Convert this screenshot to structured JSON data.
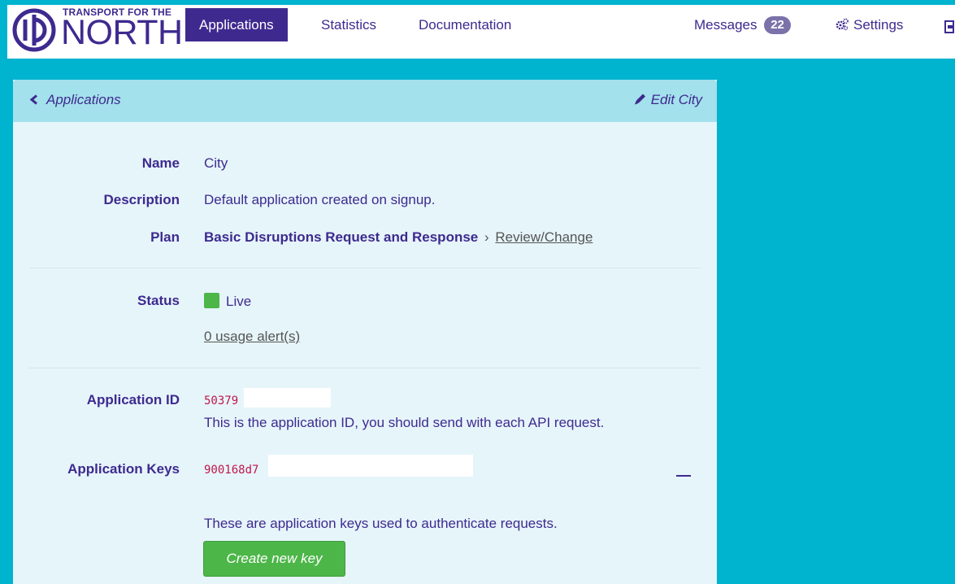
{
  "brand": {
    "small": "TRANSPORT FOR THE",
    "big": "NORTH"
  },
  "nav": {
    "applications": "Applications",
    "statistics": "Statistics",
    "documentation": "Documentation",
    "messages": "Messages",
    "messages_count": "22",
    "settings": "Settings"
  },
  "panel": {
    "back": "Applications",
    "edit": "Edit City"
  },
  "details": {
    "name_label": "Name",
    "name_value": "City",
    "description_label": "Description",
    "description_value": "Default application created on signup.",
    "plan_label": "Plan",
    "plan_value": "Basic Disruptions Request and Response",
    "plan_separator": "›",
    "plan_link": "Review/Change",
    "status_label": "Status",
    "status_value": "Live",
    "alerts_link": "0 usage alert(s)",
    "app_id_label": "Application ID",
    "app_id_value": "50379",
    "app_id_help": "This is the application ID, you should send with each API request.",
    "app_keys_label": "Application Keys",
    "app_key_value": "900168d7",
    "app_keys_help": "These are application keys used to authenticate requests.",
    "create_key_button": "Create new key"
  },
  "colors": {
    "brand": "#3e2a8f",
    "accent": "#00b3cf",
    "live": "#4cb648",
    "code": "#c0174a"
  },
  "icons": {
    "back": "chevron-left-icon",
    "edit": "pencil-icon",
    "settings": "gears-icon",
    "logout": "logout-icon"
  }
}
